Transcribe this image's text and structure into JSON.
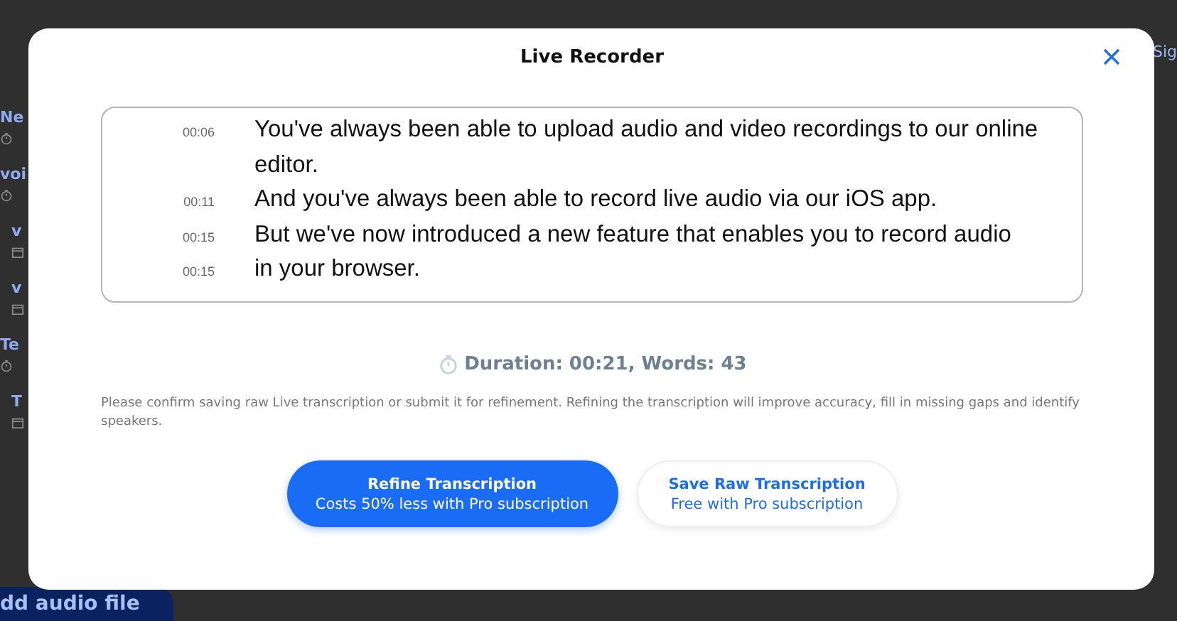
{
  "background": {
    "sign_in": "Sig",
    "sidebar_items": [
      {
        "title": "Ne",
        "kind": "timer"
      },
      {
        "title": "voi",
        "kind": "timer"
      },
      {
        "title": "v",
        "kind": "calendar"
      },
      {
        "title": "v",
        "kind": "calendar"
      },
      {
        "title": "Te",
        "kind": "timer"
      },
      {
        "title": "T",
        "kind": "calendar"
      }
    ],
    "add_button": "dd audio file"
  },
  "dialog": {
    "title": "Live Recorder",
    "transcript": [
      {
        "time": "00:06",
        "text": "You've always been able to upload audio and video recordings to our online editor."
      },
      {
        "time": "00:11",
        "text": "And you've always been able to record live audio via our iOS app."
      },
      {
        "time": "00:15",
        "text": "But we've now introduced a new feature that enables you to record audio"
      },
      {
        "time": "00:15",
        "text": "in your browser."
      }
    ],
    "stats": "Duration: 00:21, Words: 43",
    "note": "Please confirm saving raw Live transcription or submit it for refinement. Refining the transcription will improve accuracy, fill in missing gaps and identify speakers.",
    "buttons": [
      {
        "kind": "primary",
        "label": "Refine Transcription",
        "sublabel": "Costs 50% less with Pro subscription"
      },
      {
        "kind": "secondary",
        "label": "Save Raw Transcription",
        "sublabel": "Free with Pro subscription"
      }
    ]
  }
}
